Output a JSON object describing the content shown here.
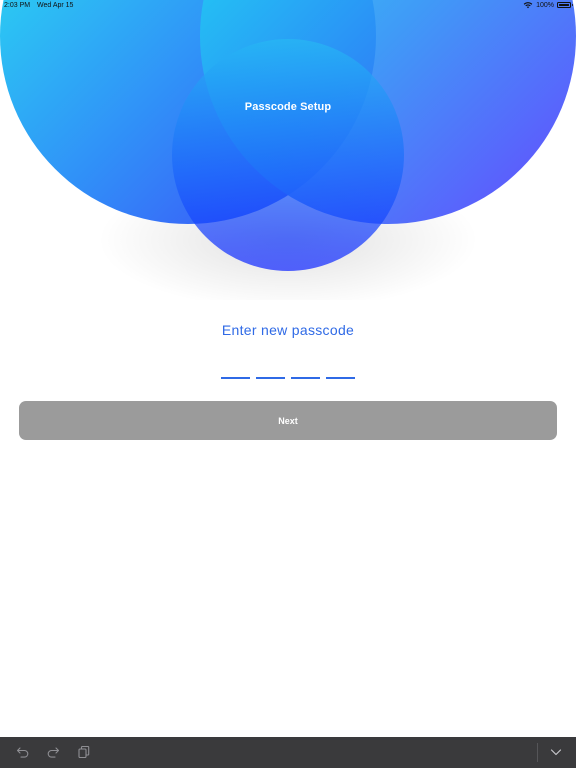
{
  "status_bar": {
    "time": "2:03 PM",
    "date": "Wed Apr 15",
    "battery": "100%"
  },
  "header": {
    "title": "Passcode Setup"
  },
  "prompt": {
    "text": "Enter new passcode"
  },
  "passcode": {
    "slot_count": 4
  },
  "next_button": {
    "label": "Next"
  },
  "toolbar": {
    "icons": [
      "undo-icon",
      "redo-icon",
      "clipboard-icon",
      "chevron-down-icon"
    ]
  },
  "colors": {
    "accent": "#2f6ae6",
    "button_disabled": "#9b9b9b",
    "toolbar": "#3a3a3c",
    "gradient_cyan": "#22e0f0",
    "gradient_blue": "#1a3cff",
    "gradient_violet": "#5a2cff"
  }
}
